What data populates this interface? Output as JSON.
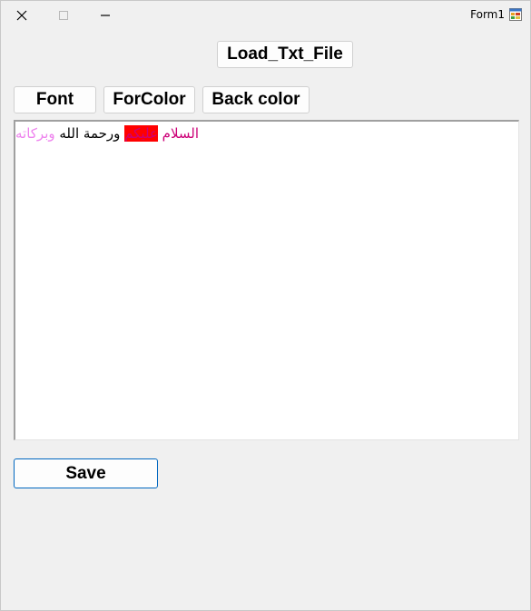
{
  "window": {
    "title": "Form1",
    "controls": {
      "close_icon": "close-icon",
      "maximize_icon": "maximize-icon",
      "minimize_icon": "minimize-icon"
    }
  },
  "toolbar": {
    "load_label": "Load_Txt_File",
    "font_label": "Font",
    "forcolor_label": "ForColor",
    "backcolor_label": "Back color",
    "save_label": "Save"
  },
  "editor": {
    "runs": [
      {
        "text": "السلام",
        "color": "#cc0077",
        "background": ""
      },
      {
        "text": " ",
        "color": "#000000",
        "background": ""
      },
      {
        "text": "عليكم",
        "color": "#cc0077",
        "background": "#ff0000"
      },
      {
        "text": " ورحمة الله ",
        "color": "#000000",
        "background": ""
      },
      {
        "text": "وبركاته",
        "color": "#ee82ee",
        "background": ""
      }
    ]
  },
  "colors": {
    "window_bg": "#f0f0f0",
    "button_bg": "#fdfdfd",
    "focus_border": "#0067c0"
  }
}
